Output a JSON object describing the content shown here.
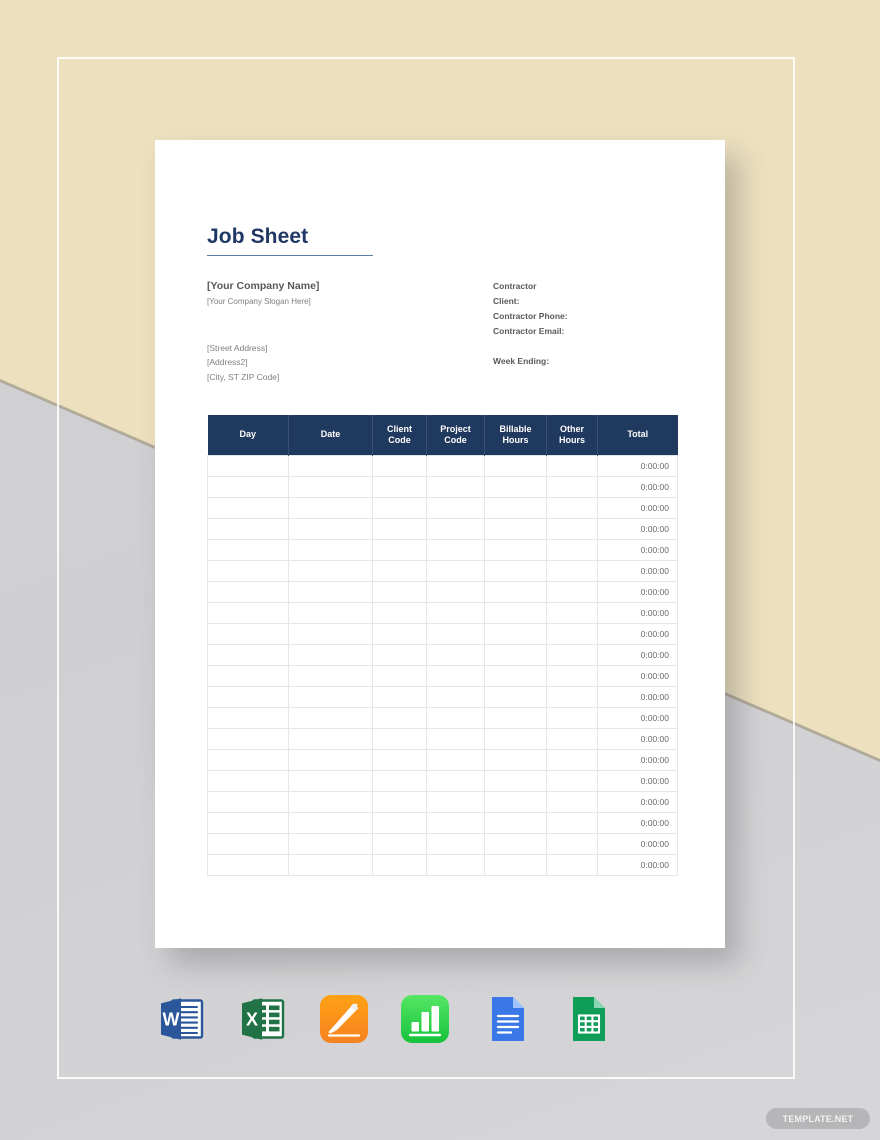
{
  "document": {
    "title": "Job Sheet",
    "company": {
      "name": "[Your Company Name]",
      "slogan": "[Your Company Slogan Here]",
      "address": [
        "[Street Address]",
        "[Address2]",
        "[City, ST ZIP Code]"
      ]
    },
    "contact": {
      "lines": [
        "Contractor",
        "Client:",
        "Contractor Phone:",
        "Contractor Email:"
      ],
      "week_ending": "Week Ending:"
    },
    "table": {
      "headers": [
        "Day",
        "Date",
        "Client Code",
        "Project Code",
        "Billable Hours",
        "Other Hours",
        "Total"
      ],
      "header_lines": [
        [
          "Day"
        ],
        [
          "Date"
        ],
        [
          "Client",
          "Code"
        ],
        [
          "Project",
          "Code"
        ],
        [
          "Billable",
          "Hours"
        ],
        [
          "Other",
          "Hours"
        ],
        [
          "Total"
        ]
      ],
      "row_count": 20,
      "default_total": "0:00:00",
      "rows": [
        {
          "day": "",
          "date": "",
          "client_code": "",
          "project_code": "",
          "billable_hours": "",
          "other_hours": "",
          "total": "0:00:00"
        },
        {
          "day": "",
          "date": "",
          "client_code": "",
          "project_code": "",
          "billable_hours": "",
          "other_hours": "",
          "total": "0:00:00"
        },
        {
          "day": "",
          "date": "",
          "client_code": "",
          "project_code": "",
          "billable_hours": "",
          "other_hours": "",
          "total": "0:00:00"
        },
        {
          "day": "",
          "date": "",
          "client_code": "",
          "project_code": "",
          "billable_hours": "",
          "other_hours": "",
          "total": "0:00:00"
        },
        {
          "day": "",
          "date": "",
          "client_code": "",
          "project_code": "",
          "billable_hours": "",
          "other_hours": "",
          "total": "0:00:00"
        },
        {
          "day": "",
          "date": "",
          "client_code": "",
          "project_code": "",
          "billable_hours": "",
          "other_hours": "",
          "total": "0:00:00"
        },
        {
          "day": "",
          "date": "",
          "client_code": "",
          "project_code": "",
          "billable_hours": "",
          "other_hours": "",
          "total": "0:00:00"
        },
        {
          "day": "",
          "date": "",
          "client_code": "",
          "project_code": "",
          "billable_hours": "",
          "other_hours": "",
          "total": "0:00:00"
        },
        {
          "day": "",
          "date": "",
          "client_code": "",
          "project_code": "",
          "billable_hours": "",
          "other_hours": "",
          "total": "0:00:00"
        },
        {
          "day": "",
          "date": "",
          "client_code": "",
          "project_code": "",
          "billable_hours": "",
          "other_hours": "",
          "total": "0:00:00"
        },
        {
          "day": "",
          "date": "",
          "client_code": "",
          "project_code": "",
          "billable_hours": "",
          "other_hours": "",
          "total": "0:00:00"
        },
        {
          "day": "",
          "date": "",
          "client_code": "",
          "project_code": "",
          "billable_hours": "",
          "other_hours": "",
          "total": "0:00:00"
        },
        {
          "day": "",
          "date": "",
          "client_code": "",
          "project_code": "",
          "billable_hours": "",
          "other_hours": "",
          "total": "0:00:00"
        },
        {
          "day": "",
          "date": "",
          "client_code": "",
          "project_code": "",
          "billable_hours": "",
          "other_hours": "",
          "total": "0:00:00"
        },
        {
          "day": "",
          "date": "",
          "client_code": "",
          "project_code": "",
          "billable_hours": "",
          "other_hours": "",
          "total": "0:00:00"
        },
        {
          "day": "",
          "date": "",
          "client_code": "",
          "project_code": "",
          "billable_hours": "",
          "other_hours": "",
          "total": "0:00:00"
        },
        {
          "day": "",
          "date": "",
          "client_code": "",
          "project_code": "",
          "billable_hours": "",
          "other_hours": "",
          "total": "0:00:00"
        },
        {
          "day": "",
          "date": "",
          "client_code": "",
          "project_code": "",
          "billable_hours": "",
          "other_hours": "",
          "total": "0:00:00"
        },
        {
          "day": "",
          "date": "",
          "client_code": "",
          "project_code": "",
          "billable_hours": "",
          "other_hours": "",
          "total": "0:00:00"
        },
        {
          "day": "",
          "date": "",
          "client_code": "",
          "project_code": "",
          "billable_hours": "",
          "other_hours": "",
          "total": "0:00:00"
        }
      ]
    }
  },
  "formats": [
    {
      "name": "ms-word-icon",
      "label": "Word",
      "glyph": "W"
    },
    {
      "name": "ms-excel-icon",
      "label": "Excel",
      "glyph": "X"
    },
    {
      "name": "apple-pages-icon",
      "label": "Pages",
      "glyph": ""
    },
    {
      "name": "apple-numbers-icon",
      "label": "Numbers",
      "glyph": ""
    },
    {
      "name": "google-docs-icon",
      "label": "Docs",
      "glyph": ""
    },
    {
      "name": "google-sheets-icon",
      "label": "Sheets",
      "glyph": ""
    }
  ],
  "watermark": {
    "text": "TEMPLATE.NET"
  },
  "colors": {
    "title": "#1f3864",
    "table_header": "#20395e",
    "background_beige": "#ece0bf",
    "background_gray": "#d3d3d5",
    "grid_line": "#e4e6e9"
  }
}
